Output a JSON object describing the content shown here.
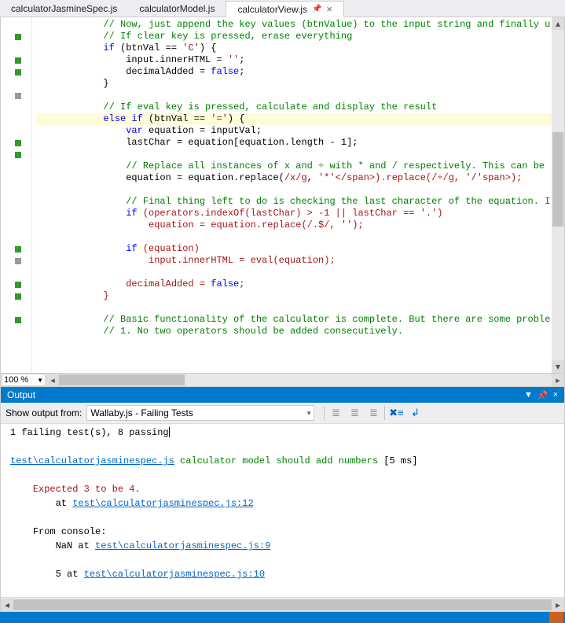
{
  "tabs": [
    {
      "label": "calculatorJasmineSpec.js",
      "active": false,
      "pinned": false
    },
    {
      "label": "calculatorModel.js",
      "active": false,
      "pinned": false
    },
    {
      "label": "calculatorView.js",
      "active": true,
      "pinned": true
    }
  ],
  "editor": {
    "zoom": "100 %",
    "gutter": [
      "",
      "green",
      "",
      "green",
      "green",
      "",
      "gray",
      "",
      "",
      "",
      "green",
      "green",
      "",
      "",
      "",
      "",
      "",
      "",
      "",
      "green",
      "gray",
      "",
      "green",
      "green",
      "",
      "green",
      "",
      "",
      "",
      ""
    ],
    "lines": [
      "            // Now, just append the key values (btnValue) to the input string and finally u",
      "            // If clear key is pressed, erase everything",
      "            if (btnVal == 'C') {",
      "                input.innerHTML = '';",
      "                decimalAdded = false;",
      "            }",
      "",
      "            // If eval key is pressed, calculate and display the result",
      "            else if (btnVal == '=') {",
      "                var equation = inputVal;",
      "                lastChar = equation[equation.length - 1];",
      "",
      "                // Replace all instances of x and ÷ with * and / respectively. This can be ",
      "                equation = equation.replace(/x/g, '*').replace(/÷/g, '/');",
      "",
      "                // Final thing left to do is checking the last character of the equation. I",
      "                if (operators.indexOf(lastChar) > -1 || lastChar == '.')",
      "                    equation = equation.replace(/.$/, '');",
      "",
      "                if (equation)",
      "                    input.innerHTML = eval(equation);",
      "",
      "                decimalAdded = false;",
      "            }",
      "",
      "            // Basic functionality of the calculator is complete. But there are some proble",
      "            // 1. No two operators should be added consecutively."
    ]
  },
  "output": {
    "title": "Output",
    "source_label": "Show output from:",
    "source_value": "Wallaby.js - Failing Tests",
    "summary": "1 failing test(s), 8 passing.",
    "test_file_link": "test\\calculatorjasminespec.js",
    "test_description": "calculator model should add numbers",
    "test_time": "[5 ms]",
    "expectation": "Expected 3 to be 4.",
    "expect_at_label": "at",
    "expect_link": "test\\calculatorjasminespec.js:12",
    "console_header": "From console:",
    "console_entries": [
      {
        "value": "NaN",
        "at": "at",
        "link": "test\\calculatorjasminespec.js:9"
      },
      {
        "value": "5",
        "at": "at",
        "link": "test\\calculatorjasminespec.js:10"
      }
    ]
  }
}
